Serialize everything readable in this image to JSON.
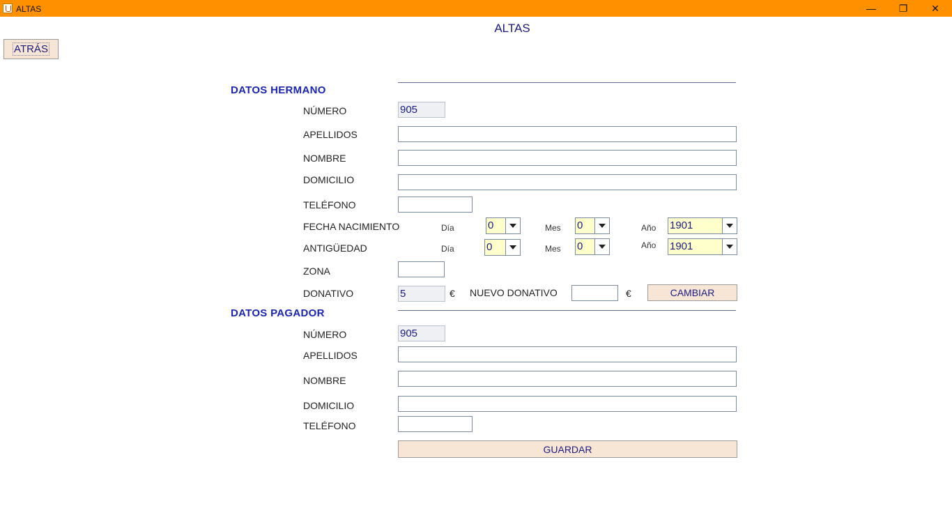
{
  "window": {
    "title": "ALTAS",
    "controls": {
      "minimize": "—",
      "maximize": "❐",
      "close": "✕"
    }
  },
  "header": {
    "title": "ALTAS",
    "back_label": "ATRÁS"
  },
  "hermano": {
    "section_title": "DATOS HERMANO",
    "numero_label": "NÚMERO",
    "numero_value": "905",
    "apellidos_label": "APELLIDOS",
    "apellidos_value": "",
    "nombre_label": "NOMBRE",
    "nombre_value": "",
    "domicilio_label": "DOMICILIO",
    "domicilio_value": "",
    "telefono_label": "TELÉFONO",
    "telefono_value": "",
    "fecha_label": "FECHA NACIMIENTO",
    "fecha": {
      "dia_label": "Día",
      "dia": "0",
      "mes_label": "Mes",
      "mes": "0",
      "anio_label": "Año",
      "anio": "1901"
    },
    "antiguedad_label": "ANTIGÜEDAD",
    "antiguedad": {
      "dia_label": "Día",
      "dia": "0",
      "mes_label": "Mes",
      "mes": "0",
      "anio_label": "Año",
      "anio": "1901"
    },
    "zona_label": "ZONA",
    "zona_value": "",
    "donativo_label": "DONATIVO",
    "donativo_value": "5",
    "currency": "€",
    "nuevo_donativo_label": "NUEVO DONATIVO",
    "nuevo_donativo_value": "",
    "cambiar_label": "CAMBIAR"
  },
  "pagador": {
    "section_title": "DATOS PAGADOR",
    "numero_label": "NÚMERO",
    "numero_value": "905",
    "apellidos_label": "APELLIDOS",
    "apellidos_value": "",
    "nombre_label": "NOMBRE",
    "nombre_value": "",
    "domicilio_label": "DOMICILIO",
    "domicilio_value": "",
    "telefono_label": "TELÉFONO",
    "telefono_value": "",
    "guardar_label": "GUARDAR"
  },
  "colors": {
    "titlebar": "#ff9100",
    "section_title": "#1a24b4",
    "field_text": "#1a1a80",
    "button_bg": "#f7e6d5",
    "combo_bg": "#ffffcc"
  }
}
